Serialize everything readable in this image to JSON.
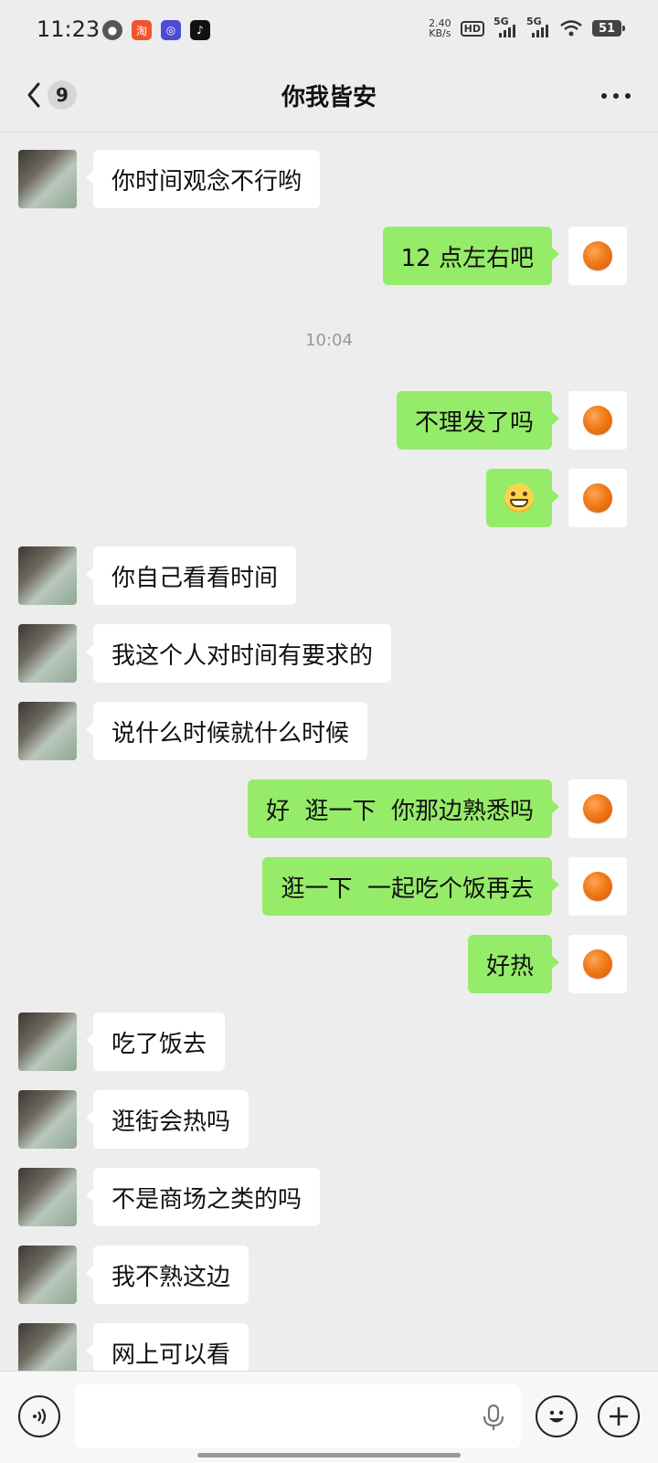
{
  "status_bar": {
    "time": "11:23",
    "net_speed": "2.40",
    "net_unit": "KB/s",
    "hd_label": "HD",
    "sim1_label": "5G",
    "sim2_label": "5G",
    "battery": "51",
    "apps": [
      "wechat-icon",
      "taobao-icon",
      "app-icon",
      "tiktok-icon"
    ]
  },
  "header": {
    "unread_count": "9",
    "title": "你我皆安"
  },
  "colors": {
    "background": "#ededed",
    "bubble_in": "#ffffff",
    "bubble_out": "#95ec69"
  },
  "timestamp": "10:04",
  "messages": [
    {
      "side": "in",
      "text": "你时间观念不行哟"
    },
    {
      "side": "out",
      "text": "12 点左右吧"
    },
    {
      "side": "out",
      "text": "不理发了吗"
    },
    {
      "side": "out",
      "text": "",
      "emoji": "grinning-face-icon"
    },
    {
      "side": "in",
      "text": "你自己看看时间"
    },
    {
      "side": "in",
      "text": "我这个人对时间有要求的"
    },
    {
      "side": "in",
      "text": "说什么时候就什么时候"
    },
    {
      "side": "out",
      "text": "好  逛一下  你那边熟悉吗"
    },
    {
      "side": "out",
      "text": "逛一下  一起吃个饭再去"
    },
    {
      "side": "out",
      "text": "好热"
    },
    {
      "side": "in",
      "text": "吃了饭去"
    },
    {
      "side": "in",
      "text": "逛街会热吗"
    },
    {
      "side": "in",
      "text": "不是商场之类的吗"
    },
    {
      "side": "in",
      "text": "我不熟这边"
    },
    {
      "side": "in",
      "text": "网上可以看"
    }
  ],
  "input": {
    "placeholder": ""
  }
}
